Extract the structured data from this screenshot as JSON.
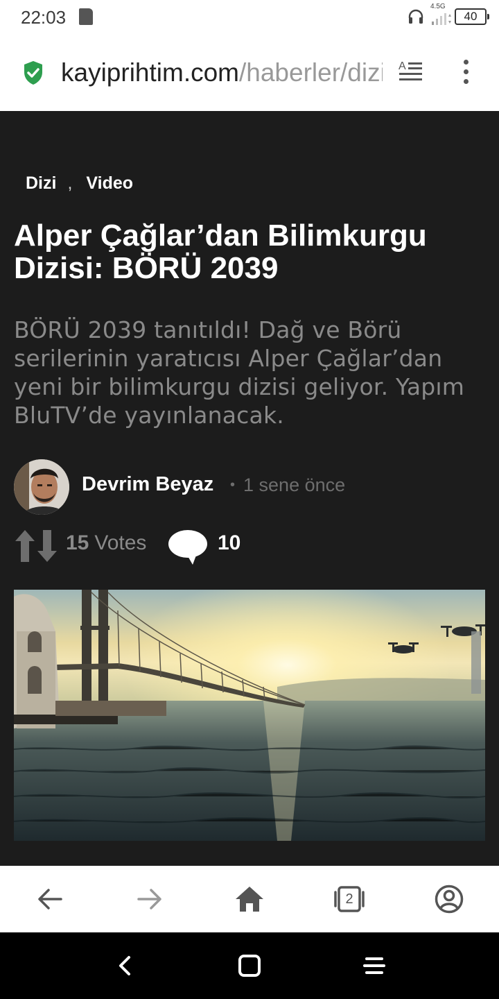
{
  "status_bar": {
    "time": "22:03",
    "network": "4.5G",
    "battery": "40",
    "icons": [
      "sd-card-icon",
      "headphones-icon",
      "signal-icon",
      "battery-icon"
    ]
  },
  "url_bar": {
    "domain": "kayiprihtim.com",
    "path": "/haberler/dizi",
    "secure": true,
    "icons": [
      "shield-check-icon",
      "reader-mode-icon",
      "overflow-menu-icon"
    ]
  },
  "article": {
    "categories": [
      "Dizi",
      "Video"
    ],
    "category_separator": ",",
    "title": "Alper Çağlar’dan Bilimkurgu Dizisi: BÖRÜ 2039",
    "summary": "BÖRÜ 2039 tanıtıldı! Dağ ve Börü serilerinin yaratıcısı Alper Çağlar’dan yeni bir bilimkurgu dizisi geliyor. Yapım BluTV’de yayınlanacak.",
    "author": "Devrim Beyaz",
    "time_ago": "1 sene önce",
    "time_separator": "•",
    "votes_count": "15",
    "votes_label": "Votes",
    "comments_count": "10"
  },
  "browser_nav": {
    "tab_count": "2",
    "icons": [
      "back-arrow-icon",
      "forward-arrow-icon",
      "home-icon",
      "tabs-icon",
      "profile-icon"
    ]
  },
  "system_nav": {
    "icons": [
      "system-back-icon",
      "system-home-icon",
      "system-menu-icon"
    ]
  },
  "colors": {
    "page_bg": "#1c1c1c",
    "accent_secure": "#2e9e4f",
    "muted_text": "#8a8a8a"
  }
}
